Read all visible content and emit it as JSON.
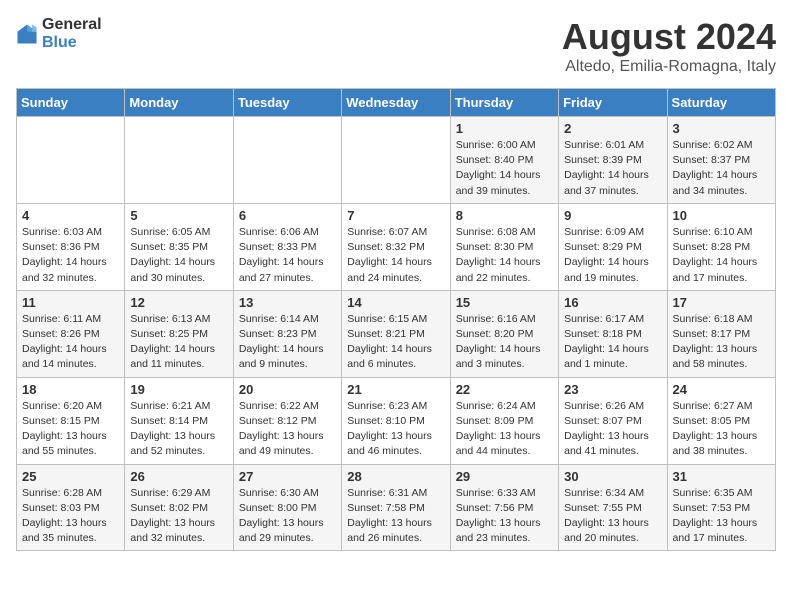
{
  "logo": {
    "text_general": "General",
    "text_blue": "Blue"
  },
  "title": "August 2024",
  "subtitle": "Altedo, Emilia-Romagna, Italy",
  "days_of_week": [
    "Sunday",
    "Monday",
    "Tuesday",
    "Wednesday",
    "Thursday",
    "Friday",
    "Saturday"
  ],
  "weeks": [
    [
      {
        "day": "",
        "info": ""
      },
      {
        "day": "",
        "info": ""
      },
      {
        "day": "",
        "info": ""
      },
      {
        "day": "",
        "info": ""
      },
      {
        "day": "1",
        "info": "Sunrise: 6:00 AM\nSunset: 8:40 PM\nDaylight: 14 hours\nand 39 minutes."
      },
      {
        "day": "2",
        "info": "Sunrise: 6:01 AM\nSunset: 8:39 PM\nDaylight: 14 hours\nand 37 minutes."
      },
      {
        "day": "3",
        "info": "Sunrise: 6:02 AM\nSunset: 8:37 PM\nDaylight: 14 hours\nand 34 minutes."
      }
    ],
    [
      {
        "day": "4",
        "info": "Sunrise: 6:03 AM\nSunset: 8:36 PM\nDaylight: 14 hours\nand 32 minutes."
      },
      {
        "day": "5",
        "info": "Sunrise: 6:05 AM\nSunset: 8:35 PM\nDaylight: 14 hours\nand 30 minutes."
      },
      {
        "day": "6",
        "info": "Sunrise: 6:06 AM\nSunset: 8:33 PM\nDaylight: 14 hours\nand 27 minutes."
      },
      {
        "day": "7",
        "info": "Sunrise: 6:07 AM\nSunset: 8:32 PM\nDaylight: 14 hours\nand 24 minutes."
      },
      {
        "day": "8",
        "info": "Sunrise: 6:08 AM\nSunset: 8:30 PM\nDaylight: 14 hours\nand 22 minutes."
      },
      {
        "day": "9",
        "info": "Sunrise: 6:09 AM\nSunset: 8:29 PM\nDaylight: 14 hours\nand 19 minutes."
      },
      {
        "day": "10",
        "info": "Sunrise: 6:10 AM\nSunset: 8:28 PM\nDaylight: 14 hours\nand 17 minutes."
      }
    ],
    [
      {
        "day": "11",
        "info": "Sunrise: 6:11 AM\nSunset: 8:26 PM\nDaylight: 14 hours\nand 14 minutes."
      },
      {
        "day": "12",
        "info": "Sunrise: 6:13 AM\nSunset: 8:25 PM\nDaylight: 14 hours\nand 11 minutes."
      },
      {
        "day": "13",
        "info": "Sunrise: 6:14 AM\nSunset: 8:23 PM\nDaylight: 14 hours\nand 9 minutes."
      },
      {
        "day": "14",
        "info": "Sunrise: 6:15 AM\nSunset: 8:21 PM\nDaylight: 14 hours\nand 6 minutes."
      },
      {
        "day": "15",
        "info": "Sunrise: 6:16 AM\nSunset: 8:20 PM\nDaylight: 14 hours\nand 3 minutes."
      },
      {
        "day": "16",
        "info": "Sunrise: 6:17 AM\nSunset: 8:18 PM\nDaylight: 14 hours\nand 1 minute."
      },
      {
        "day": "17",
        "info": "Sunrise: 6:18 AM\nSunset: 8:17 PM\nDaylight: 13 hours\nand 58 minutes."
      }
    ],
    [
      {
        "day": "18",
        "info": "Sunrise: 6:20 AM\nSunset: 8:15 PM\nDaylight: 13 hours\nand 55 minutes."
      },
      {
        "day": "19",
        "info": "Sunrise: 6:21 AM\nSunset: 8:14 PM\nDaylight: 13 hours\nand 52 minutes."
      },
      {
        "day": "20",
        "info": "Sunrise: 6:22 AM\nSunset: 8:12 PM\nDaylight: 13 hours\nand 49 minutes."
      },
      {
        "day": "21",
        "info": "Sunrise: 6:23 AM\nSunset: 8:10 PM\nDaylight: 13 hours\nand 46 minutes."
      },
      {
        "day": "22",
        "info": "Sunrise: 6:24 AM\nSunset: 8:09 PM\nDaylight: 13 hours\nand 44 minutes."
      },
      {
        "day": "23",
        "info": "Sunrise: 6:26 AM\nSunset: 8:07 PM\nDaylight: 13 hours\nand 41 minutes."
      },
      {
        "day": "24",
        "info": "Sunrise: 6:27 AM\nSunset: 8:05 PM\nDaylight: 13 hours\nand 38 minutes."
      }
    ],
    [
      {
        "day": "25",
        "info": "Sunrise: 6:28 AM\nSunset: 8:03 PM\nDaylight: 13 hours\nand 35 minutes."
      },
      {
        "day": "26",
        "info": "Sunrise: 6:29 AM\nSunset: 8:02 PM\nDaylight: 13 hours\nand 32 minutes."
      },
      {
        "day": "27",
        "info": "Sunrise: 6:30 AM\nSunset: 8:00 PM\nDaylight: 13 hours\nand 29 minutes."
      },
      {
        "day": "28",
        "info": "Sunrise: 6:31 AM\nSunset: 7:58 PM\nDaylight: 13 hours\nand 26 minutes."
      },
      {
        "day": "29",
        "info": "Sunrise: 6:33 AM\nSunset: 7:56 PM\nDaylight: 13 hours\nand 23 minutes."
      },
      {
        "day": "30",
        "info": "Sunrise: 6:34 AM\nSunset: 7:55 PM\nDaylight: 13 hours\nand 20 minutes."
      },
      {
        "day": "31",
        "info": "Sunrise: 6:35 AM\nSunset: 7:53 PM\nDaylight: 13 hours\nand 17 minutes."
      }
    ]
  ]
}
